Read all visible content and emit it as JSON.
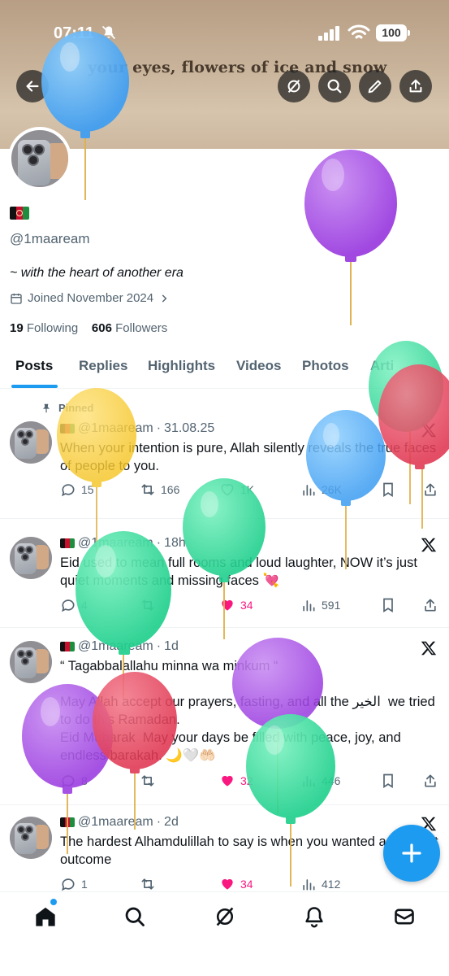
{
  "status_bar": {
    "time": "07:11",
    "battery": "100"
  },
  "banner": {
    "text": "your eyes,  flowers of ice and snow"
  },
  "profile": {
    "handle": "@1maaream",
    "bio": "~ with the heart of another era",
    "joined": "Joined November 2024",
    "following_count": "19",
    "following_label": "Following",
    "followers_count": "606",
    "followers_label": "Followers"
  },
  "tabs": [
    "Posts",
    "Replies",
    "Highlights",
    "Videos",
    "Photos",
    "Arti"
  ],
  "tweets": [
    {
      "pinned_label": "Pinned",
      "handle": "@1maaream",
      "time": "31.08.25",
      "text": "When your intention is pure, Allah silently reveals the true faces of people to you.",
      "replies": "15",
      "reposts": "166",
      "likes": "1K",
      "views": "26K"
    },
    {
      "handle": "@1maaream",
      "time": "18h",
      "text": "Eid used to mean full rooms and loud laughter, NOW it’s just quiet moments and missing faces 💘",
      "replies": "4",
      "reposts": "",
      "likes": "34",
      "views": "591"
    },
    {
      "handle": "@1maaream",
      "time": "1d",
      "text": "“ Tagabbalallahu minna wa minkum “\n\nMay Allah accept our prayers, fasting, and all the الخير  we tried to do this Ramadan.\nEid Mubarak  May your days be filled with peace, joy, and endless barakah. 🌙🤍🤲🏻",
      "replies": "8",
      "reposts": "",
      "likes": "32",
      "views": "446"
    },
    {
      "handle": "@1maaream",
      "time": "2d",
      "text": "The hardest Alhamdulillah to say is when you wanted a different outcome",
      "replies": "1",
      "reposts": "",
      "likes": "34",
      "views": "412"
    }
  ],
  "colors": {
    "accent": "#1d9bf0",
    "like": "#f91880",
    "muted": "#536471",
    "text": "#0f1419"
  },
  "icons": [
    "back-arrow-icon",
    "grok-icon",
    "search-icon",
    "edit-icon",
    "share-icon",
    "calendar-icon",
    "pin-icon",
    "x-logo-icon",
    "reply-icon",
    "repost-icon",
    "heart-icon",
    "views-icon",
    "bookmark-icon",
    "home-icon",
    "notifications-icon",
    "messages-icon",
    "plus-icon"
  ]
}
